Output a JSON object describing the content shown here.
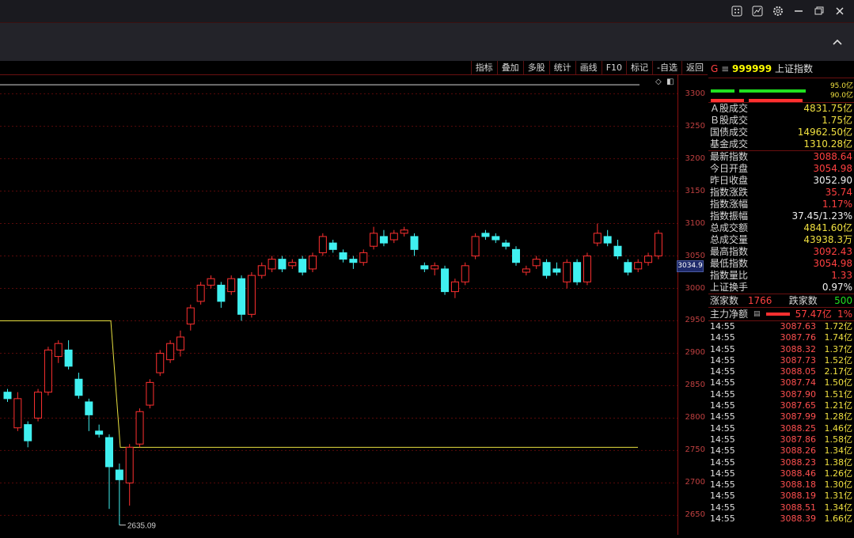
{
  "window": {
    "icons": [
      "grid-icon",
      "chart-icon",
      "gear-icon",
      "minimize-icon",
      "restore-icon",
      "close-icon"
    ]
  },
  "toolbar": {
    "items": [
      "指标",
      "叠加",
      "多股",
      "统计",
      "画线",
      "F10",
      "标记",
      "-自选",
      "返回"
    ]
  },
  "chart": {
    "y_labels": [
      "3300",
      "3250",
      "3200",
      "3150",
      "3100",
      "3050",
      "3000",
      "2950",
      "2900",
      "2850",
      "2800",
      "2750",
      "2700",
      "2650"
    ],
    "current_price_tag": "3034.9",
    "low_annotation": "2635.09"
  },
  "chart_data": {
    "type": "candlestick",
    "ylim": [
      2620,
      3330
    ],
    "y_ticks": [
      3300,
      3250,
      3200,
      3150,
      3100,
      3050,
      3000,
      2950,
      2900,
      2850,
      2800,
      2750,
      2700,
      2650
    ],
    "low_label": 2635.09,
    "current": 3034.9,
    "candles": [
      [
        2840,
        2830,
        2845,
        2825
      ],
      [
        2785,
        2830,
        2840,
        2780
      ],
      [
        2790,
        2765,
        2795,
        2755
      ],
      [
        2800,
        2840,
        2845,
        2795
      ],
      [
        2840,
        2905,
        2910,
        2835
      ],
      [
        2895,
        2915,
        2920,
        2885
      ],
      [
        2905,
        2880,
        2920,
        2875
      ],
      [
        2860,
        2835,
        2870,
        2830
      ],
      [
        2825,
        2805,
        2830,
        2780
      ],
      [
        2780,
        2775,
        2790,
        2770
      ],
      [
        2770,
        2725,
        2775,
        2660
      ],
      [
        2720,
        2705,
        2730,
        2635
      ],
      [
        2700,
        2755,
        2760,
        2665
      ],
      [
        2760,
        2810,
        2815,
        2755
      ],
      [
        2820,
        2855,
        2860,
        2815
      ],
      [
        2870,
        2900,
        2905,
        2865
      ],
      [
        2890,
        2915,
        2920,
        2885
      ],
      [
        2905,
        2925,
        2935,
        2895
      ],
      [
        2945,
        2970,
        2975,
        2935
      ],
      [
        2980,
        3005,
        3010,
        2975
      ],
      [
        3005,
        3015,
        3020,
        3000
      ],
      [
        3005,
        2980,
        3010,
        2970
      ],
      [
        2995,
        3015,
        3020,
        2990
      ],
      [
        3015,
        2960,
        3020,
        2950
      ],
      [
        2960,
        3020,
        3025,
        2955
      ],
      [
        3020,
        3035,
        3040,
        3015
      ],
      [
        3030,
        3045,
        3050,
        3025
      ],
      [
        3045,
        3030,
        3050,
        3025
      ],
      [
        3035,
        3040,
        3045,
        3030
      ],
      [
        3045,
        3025,
        3050,
        3020
      ],
      [
        3030,
        3050,
        3055,
        3025
      ],
      [
        3055,
        3080,
        3085,
        3050
      ],
      [
        3070,
        3060,
        3075,
        3055
      ],
      [
        3055,
        3045,
        3060,
        3040
      ],
      [
        3045,
        3040,
        3050,
        3030
      ],
      [
        3040,
        3055,
        3060,
        3035
      ],
      [
        3065,
        3085,
        3095,
        3060
      ],
      [
        3080,
        3070,
        3090,
        3065
      ],
      [
        3075,
        3085,
        3090,
        3070
      ],
      [
        3085,
        3090,
        3095,
        3080
      ],
      [
        3080,
        3060,
        3085,
        3050
      ],
      [
        3035,
        3030,
        3040,
        3025
      ],
      [
        3030,
        3035,
        3040,
        3020
      ],
      [
        3030,
        2995,
        3035,
        2990
      ],
      [
        2995,
        3010,
        3015,
        2985
      ],
      [
        3010,
        3035,
        3040,
        3005
      ],
      [
        3050,
        3080,
        3085,
        3045
      ],
      [
        3085,
        3080,
        3090,
        3075
      ],
      [
        3080,
        3075,
        3085,
        3070
      ],
      [
        3070,
        3065,
        3075,
        3060
      ],
      [
        3060,
        3040,
        3065,
        3035
      ],
      [
        3025,
        3030,
        3035,
        3020
      ],
      [
        3035,
        3045,
        3050,
        3030
      ],
      [
        3040,
        3020,
        3045,
        3015
      ],
      [
        3030,
        3025,
        3040,
        3020
      ],
      [
        3010,
        3040,
        3045,
        3000
      ],
      [
        3040,
        3010,
        3045,
        3005
      ],
      [
        3010,
        3050,
        3055,
        3005
      ],
      [
        3070,
        3085,
        3100,
        3065
      ],
      [
        3080,
        3070,
        3090,
        3065
      ],
      [
        3065,
        3050,
        3075,
        3045
      ],
      [
        3040,
        3025,
        3045,
        3020
      ],
      [
        3030,
        3040,
        3045,
        3025
      ],
      [
        3040,
        3050,
        3055,
        3035
      ],
      [
        3050,
        3085,
        3090,
        3045
      ]
    ],
    "yellow_line": [
      [
        0,
        2950
      ],
      [
        140,
        2950
      ],
      [
        152,
        2755
      ],
      [
        806,
        2755
      ]
    ],
    "white_line_y": 3314
  },
  "panel": {
    "header": {
      "flag": "G",
      "menu": "≡",
      "code": "999999",
      "name": "上证指数"
    },
    "bars": {
      "top_value": "95.0亿",
      "bottom_value": "90.0亿"
    },
    "trade": [
      {
        "label": "Ａ股成交",
        "value": "4831.75亿"
      },
      {
        "label": "Ｂ股成交",
        "value": "1.75亿"
      },
      {
        "label": "国债成交",
        "value": "14962.50亿"
      },
      {
        "label": "基金成交",
        "value": "1310.28亿"
      }
    ],
    "quote": [
      {
        "label": "最新指数",
        "value": "3088.64",
        "color": "red"
      },
      {
        "label": "今日开盘",
        "value": "3054.98",
        "color": "red"
      },
      {
        "label": "昨日收盘",
        "value": "3052.90",
        "color": "wht"
      },
      {
        "label": "指数涨跌",
        "value": "35.74",
        "color": "red"
      },
      {
        "label": "指数涨幅",
        "value": "1.17%",
        "color": "red"
      },
      {
        "label": "指数振幅",
        "value": "37.45/1.23%",
        "color": "wht"
      },
      {
        "label": "总成交额",
        "value": "4841.60亿",
        "color": "yel"
      },
      {
        "label": "总成交量",
        "value": "43938.3万",
        "color": "yel"
      },
      {
        "label": "最高指数",
        "value": "3092.43",
        "color": "red"
      },
      {
        "label": "最低指数",
        "value": "3054.98",
        "color": "red"
      },
      {
        "label": "指数量比",
        "value": "1.33",
        "color": "red"
      },
      {
        "label": "上证换手",
        "value": "0.97%",
        "color": "wht"
      }
    ],
    "breadth": {
      "up_label": "涨家数",
      "up_value": "1766",
      "down_label": "跌家数",
      "down_value": "500"
    },
    "main_flow": {
      "label": "主力净额",
      "value": "57.47亿",
      "pct": "1%"
    },
    "ticks": [
      [
        "14:55",
        "3087.63",
        "1.72亿"
      ],
      [
        "14:55",
        "3087.76",
        "1.74亿"
      ],
      [
        "14:55",
        "3088.32",
        "1.37亿"
      ],
      [
        "14:55",
        "3087.73",
        "1.52亿"
      ],
      [
        "14:55",
        "3088.05",
        "2.17亿"
      ],
      [
        "14:55",
        "3087.74",
        "1.50亿"
      ],
      [
        "14:55",
        "3087.90",
        "1.51亿"
      ],
      [
        "14:55",
        "3087.65",
        "1.21亿"
      ],
      [
        "14:55",
        "3087.99",
        "1.28亿"
      ],
      [
        "14:55",
        "3088.25",
        "1.46亿"
      ],
      [
        "14:55",
        "3087.86",
        "1.58亿"
      ],
      [
        "14:55",
        "3088.26",
        "1.34亿"
      ],
      [
        "14:55",
        "3088.23",
        "1.38亿"
      ],
      [
        "14:55",
        "3088.46",
        "1.26亿"
      ],
      [
        "14:55",
        "3088.18",
        "1.30亿"
      ],
      [
        "14:55",
        "3088.19",
        "1.31亿"
      ],
      [
        "14:55",
        "3088.51",
        "1.34亿"
      ],
      [
        "14:55",
        "3088.39",
        "1.66亿"
      ]
    ]
  }
}
